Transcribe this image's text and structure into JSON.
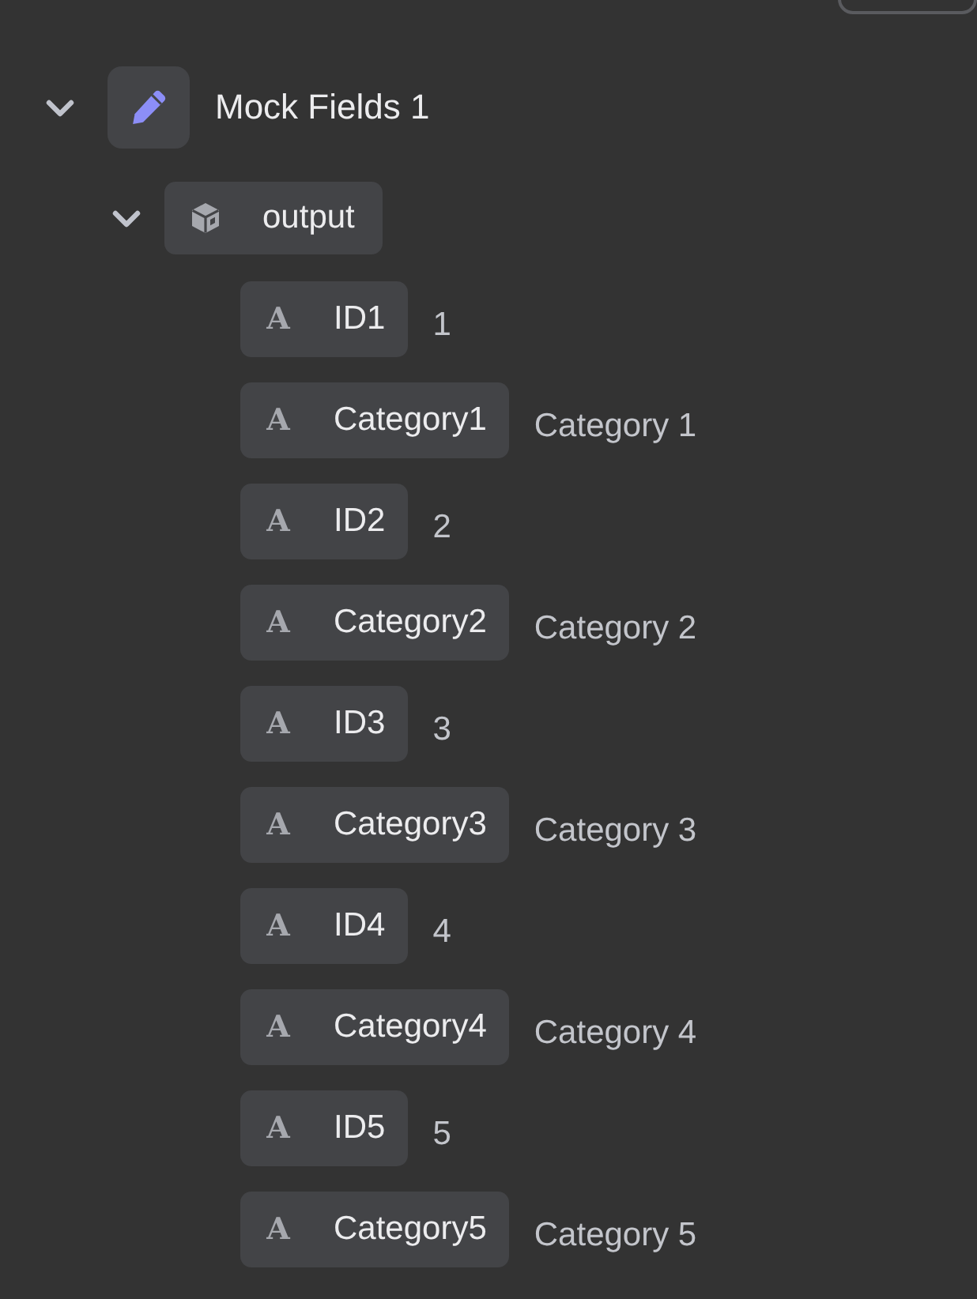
{
  "tree": [
    {
      "label": "Mock Fields 1",
      "kind": "step",
      "expanded": true,
      "children": [
        {
          "label": "output",
          "kind": "object",
          "expanded": true,
          "children": [
            {
              "label": "ID1",
              "kind": "text",
              "type_icon": "A",
              "value": "1"
            },
            {
              "label": "Category1",
              "kind": "text",
              "type_icon": "A",
              "value": "Category 1"
            },
            {
              "label": "ID2",
              "kind": "text",
              "type_icon": "A",
              "value": "2"
            },
            {
              "label": "Category2",
              "kind": "text",
              "type_icon": "A",
              "value": "Category 2"
            },
            {
              "label": "ID3",
              "kind": "text",
              "type_icon": "A",
              "value": "3"
            },
            {
              "label": "Category3",
              "kind": "text",
              "type_icon": "A",
              "value": "Category 3"
            },
            {
              "label": "ID4",
              "kind": "text",
              "type_icon": "A",
              "value": "4"
            },
            {
              "label": "Category4",
              "kind": "text",
              "type_icon": "A",
              "value": "Category 4"
            },
            {
              "label": "ID5",
              "kind": "text",
              "type_icon": "A",
              "value": "5"
            },
            {
              "label": "Category5",
              "kind": "text",
              "type_icon": "A",
              "value": "Category 5"
            }
          ]
        }
      ]
    }
  ]
}
